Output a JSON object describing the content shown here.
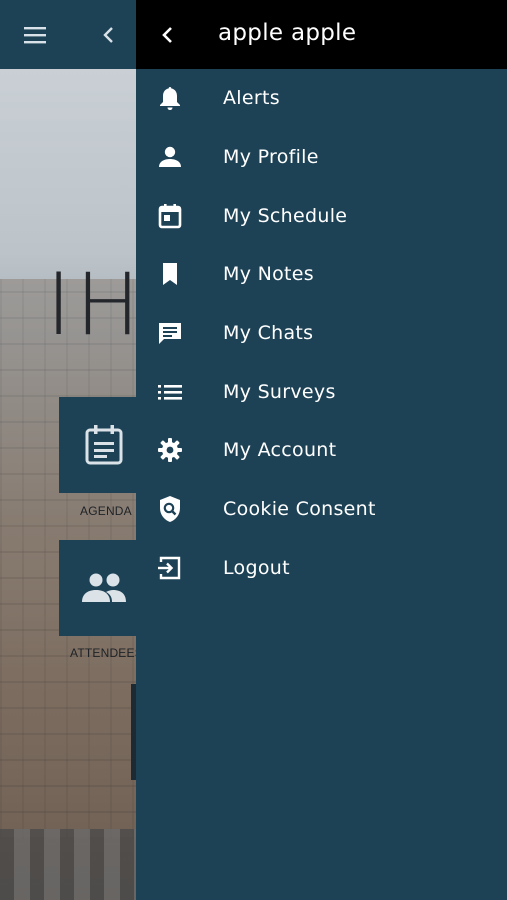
{
  "drawer": {
    "title": "apple apple",
    "items": [
      {
        "label": "Alerts",
        "icon": "bell-icon"
      },
      {
        "label": "My Profile",
        "icon": "person-icon"
      },
      {
        "label": "My Schedule",
        "icon": "calendar-icon"
      },
      {
        "label": "My Notes",
        "icon": "bookmark-icon"
      },
      {
        "label": "My Chats",
        "icon": "chat-icon"
      },
      {
        "label": "My Surveys",
        "icon": "list-icon"
      },
      {
        "label": "My Account",
        "icon": "gear-icon"
      },
      {
        "label": "Cookie Consent",
        "icon": "shield-search-icon"
      },
      {
        "label": "Logout",
        "icon": "logout-icon"
      }
    ]
  },
  "background": {
    "logo_text": "IH",
    "tiles": [
      {
        "label": "AGENDA",
        "icon": "agenda-icon"
      },
      {
        "label": "ATTENDEES",
        "icon": "people-icon"
      }
    ]
  },
  "colors": {
    "drawer_bg": "#1d4256",
    "header_bg": "#000000",
    "text": "#ffffff"
  }
}
